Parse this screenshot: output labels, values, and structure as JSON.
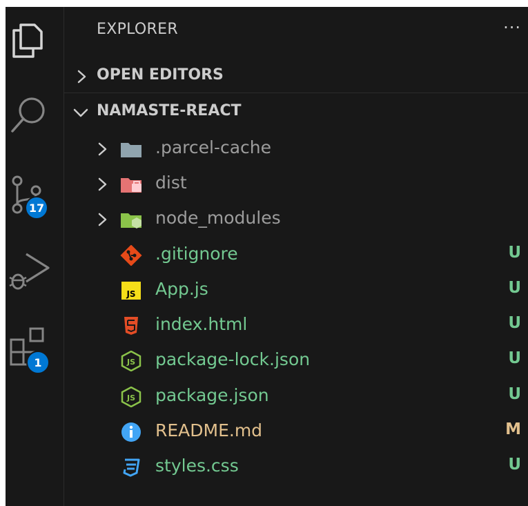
{
  "activity_bar": {
    "items": [
      {
        "name": "explorer",
        "icon": "files-icon"
      },
      {
        "name": "search",
        "icon": "search-icon"
      },
      {
        "name": "source-control",
        "icon": "source-control-icon",
        "badge": "17"
      },
      {
        "name": "run-debug",
        "icon": "run-debug-icon"
      },
      {
        "name": "extensions",
        "icon": "extensions-icon",
        "badge": "1"
      }
    ]
  },
  "sidebar": {
    "title": "EXPLORER",
    "more_label": "···",
    "open_editors_label": "OPEN EDITORS",
    "project_label": "NAMASTE-REACT",
    "files": [
      {
        "name": ".parcel-cache",
        "type": "folder",
        "icon": "folder-icon",
        "status": "",
        "color": "#9d9d9d",
        "icon_color": "#90a4ae"
      },
      {
        "name": "dist",
        "type": "folder",
        "icon": "folder-dist-icon",
        "status": "",
        "color": "#9d9d9d",
        "icon_color": "#e57373"
      },
      {
        "name": "node_modules",
        "type": "folder",
        "icon": "folder-node-icon",
        "status": "",
        "color": "#9d9d9d",
        "icon_color": "#8bc34a"
      },
      {
        "name": ".gitignore",
        "type": "file",
        "icon": "git-icon",
        "status": "U",
        "color": "#73c991",
        "icon_color": "#e64a19"
      },
      {
        "name": "App.js",
        "type": "file",
        "icon": "javascript-icon",
        "status": "U",
        "color": "#73c991",
        "icon_color": "#f5de19"
      },
      {
        "name": "index.html",
        "type": "file",
        "icon": "html-icon",
        "status": "U",
        "color": "#73c991",
        "icon_color": "#e44d26"
      },
      {
        "name": "package-lock.json",
        "type": "file",
        "icon": "nodejs-icon",
        "status": "U",
        "color": "#73c991",
        "icon_color": "#8bc34a"
      },
      {
        "name": "package.json",
        "type": "file",
        "icon": "nodejs-icon",
        "status": "U",
        "color": "#73c991",
        "icon_color": "#8bc34a"
      },
      {
        "name": "README.md",
        "type": "file",
        "icon": "info-icon",
        "status": "M",
        "color": "#e2c08d",
        "icon_color": "#42a5f5"
      },
      {
        "name": "styles.css",
        "type": "file",
        "icon": "css-icon",
        "status": "U",
        "color": "#73c991",
        "icon_color": "#42a5f5"
      }
    ]
  }
}
